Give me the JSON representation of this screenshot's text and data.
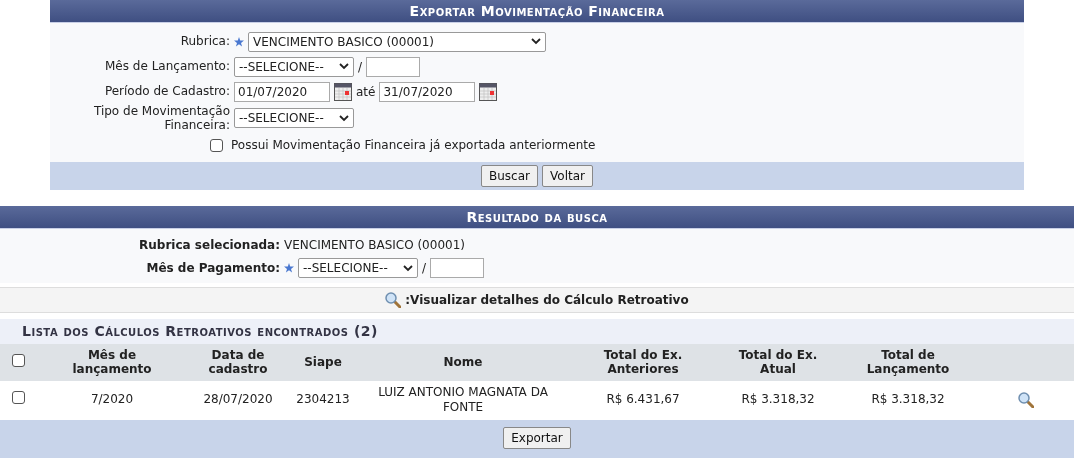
{
  "form": {
    "title": "Exportar Movimentação Financeira",
    "fields": [
      {
        "kind": "select",
        "label": "Rubrica:",
        "required": true,
        "value": "VENCIMENTO BASICO (00001)"
      },
      {
        "kind": "month_year",
        "label": "Mês de Lançamento:",
        "required": false,
        "value": "--SELECIONE--",
        "separator": "/"
      },
      {
        "kind": "date_range",
        "label": "Período de Cadastro:",
        "required": false,
        "start": "01/07/2020",
        "joiner": "até",
        "end": "31/07/2020"
      },
      {
        "kind": "select",
        "label": "Tipo de Movimentação Financeira:",
        "required": false,
        "value": "--SELECIONE--"
      }
    ],
    "checkbox": {
      "label": "Possui Movimentação Financeira já exportada anteriormente",
      "checked": false
    },
    "buttons": [
      "Buscar",
      "Voltar"
    ]
  },
  "results": {
    "title": "Resultado da busca",
    "rubrica": {
      "label": "Rubrica selecionada:",
      "value": "VENCIMENTO BASICO (00001)"
    },
    "pagamento": {
      "label": "Mês de Pagamento:",
      "required": true,
      "value": "--SELECIONE--",
      "separator": "/"
    },
    "legend": ":Visualizar detalhes do Cálculo Retroativo",
    "list_title": "Lista dos Cálculos Retroativos encontrados (2)",
    "select_all": {
      "checked": false
    },
    "columns": [
      "Mês de lançamento",
      "Data de cadastro",
      "Siape",
      "Nome",
      "Total do Ex. Anteriores",
      "Total do Ex. Atual",
      "Total de Lançamento"
    ],
    "rows": [
      {
        "checked": false,
        "cells": [
          "7/2020",
          "28/07/2020",
          "2304213",
          "LUIZ ANTONIO MAGNATA DA FONTE",
          "R$ 6.431,67",
          "R$ 3.318,32",
          "R$ 3.318,32"
        ]
      }
    ],
    "button": "Exportar"
  }
}
